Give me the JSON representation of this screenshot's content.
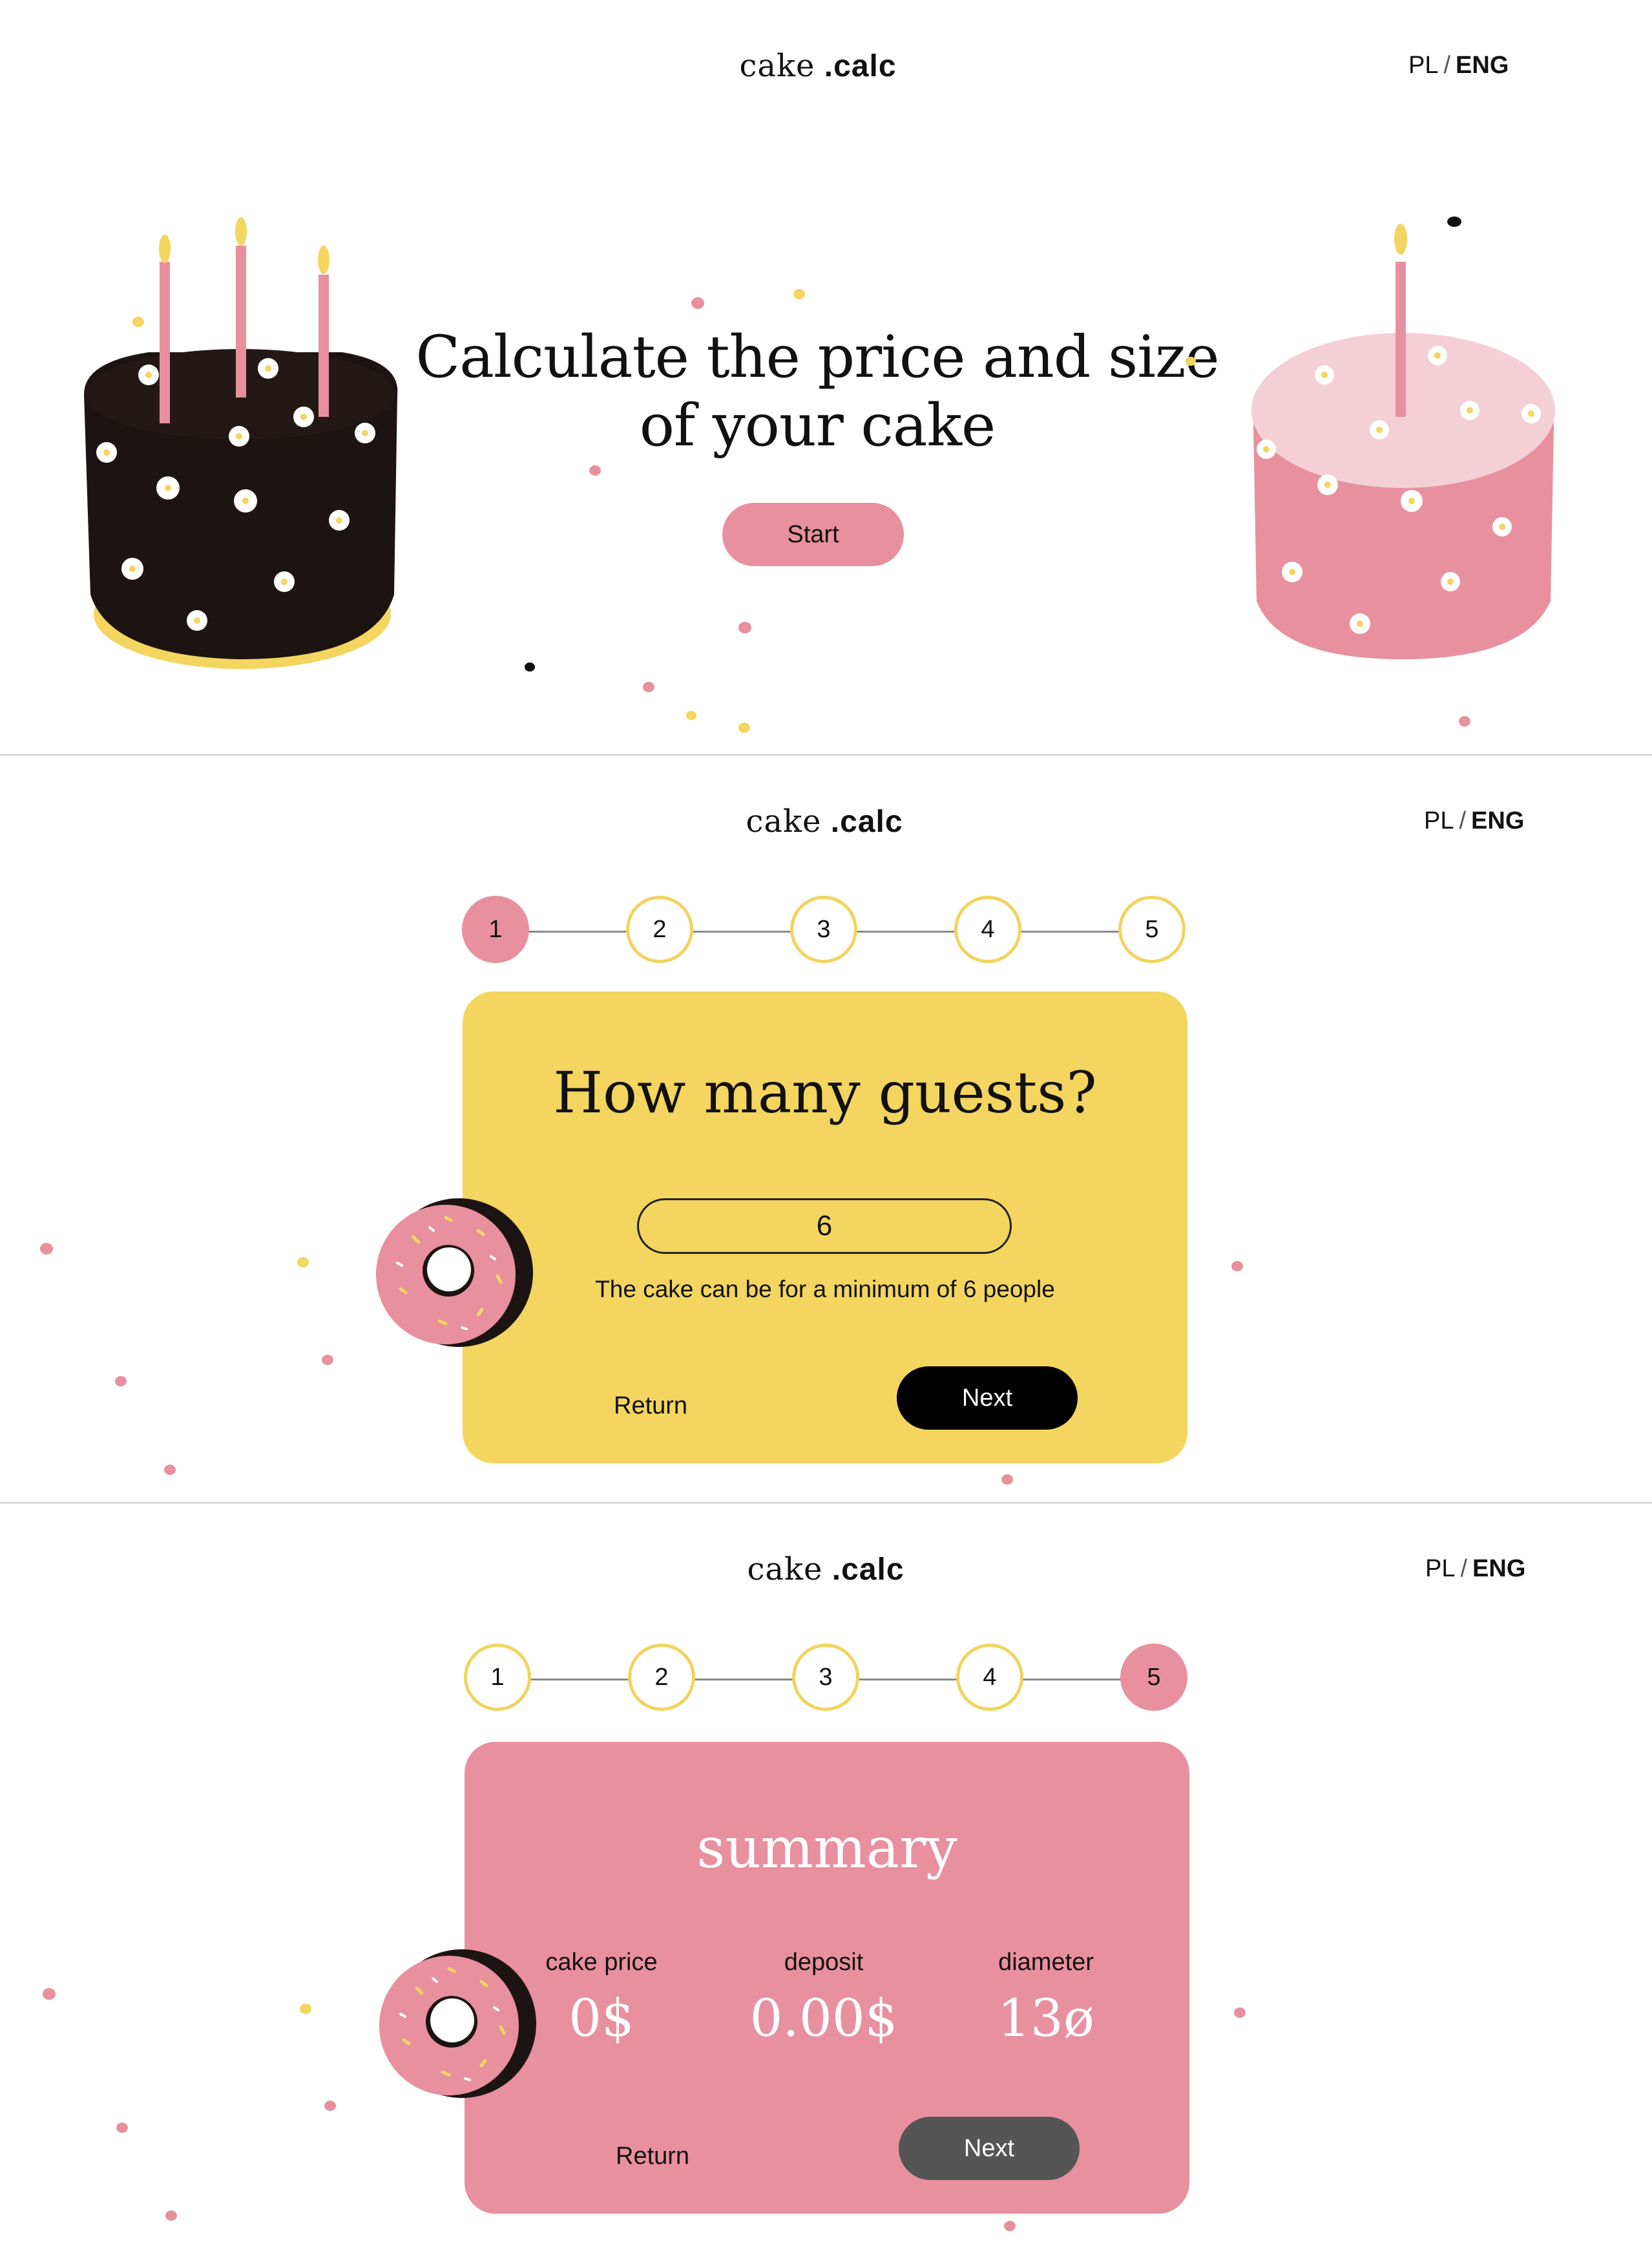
{
  "brand": {
    "word": "cake",
    "dot_word": ".calc"
  },
  "lang": {
    "pl": "PL",
    "sep": "/",
    "eng": "ENG"
  },
  "hero": {
    "title_line1": "Calculate the price and size",
    "title_line2": "of your cake",
    "start": "Start"
  },
  "steps": [
    "1",
    "2",
    "3",
    "4",
    "5"
  ],
  "guests": {
    "title": "How many guests?",
    "value": "6",
    "hint": "The cake can be for a minimum of 6 people",
    "return": "Return",
    "next": "Next"
  },
  "summary": {
    "title": "summary",
    "cols": [
      {
        "label": "cake price",
        "value": "0$"
      },
      {
        "label": "deposit",
        "value": "0.00$"
      },
      {
        "label": "diameter",
        "value": "13ø"
      }
    ],
    "return": "Return",
    "next": "Next"
  },
  "colors": {
    "pink": "#e8909e",
    "yellow": "#f3d55f",
    "dark": "#1c1412"
  }
}
